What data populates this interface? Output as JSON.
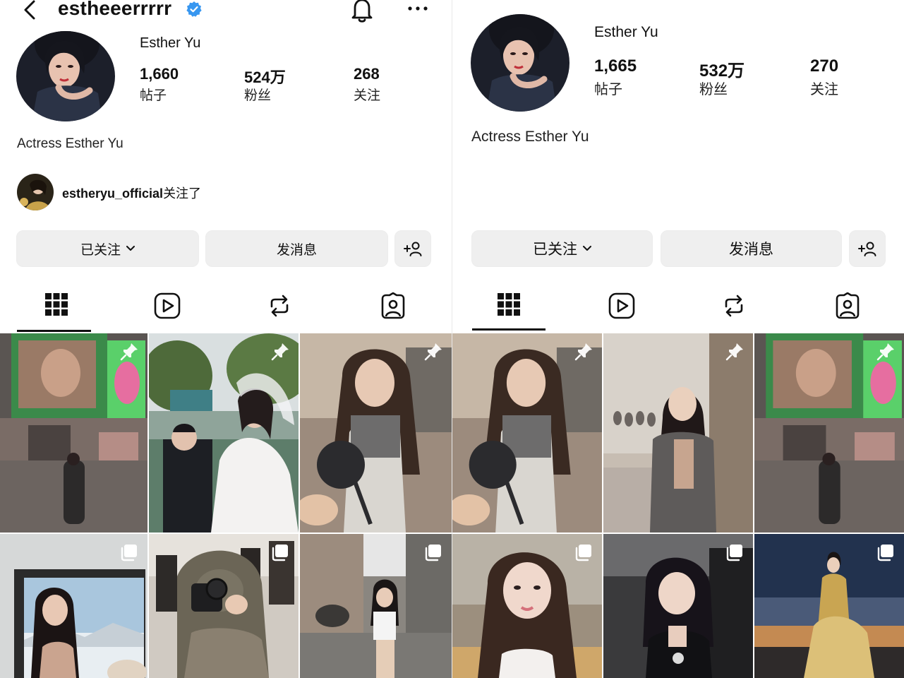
{
  "left": {
    "handle": "estheeerrrrr",
    "name": "Esther Yu",
    "stats": [
      {
        "value": "1,660",
        "label": "帖子"
      },
      {
        "value": "524万",
        "label": "粉丝"
      },
      {
        "value": "268",
        "label": "关注"
      }
    ],
    "bio": "Actress Esther Yu",
    "followed_by": {
      "user": "estheryu_official",
      "suffix": "关注了"
    },
    "buttons": {
      "following": "已关注",
      "message": "发消息"
    },
    "tab_icons": [
      "grid-icon",
      "reels-icon",
      "repost-icon",
      "tagged-icon"
    ],
    "tiles": [
      {
        "scene": "city-billboard-street",
        "badge": "pin-icon"
      },
      {
        "scene": "wedding-proposal",
        "badge": "pin-icon"
      },
      {
        "scene": "girl-with-microphone",
        "badge": "pin-icon"
      },
      {
        "scene": "window-snow-mountains",
        "badge": "carousel-icon"
      },
      {
        "scene": "mirror-selfie-closet",
        "badge": "carousel-icon"
      },
      {
        "scene": "alley-street",
        "badge": "carousel-icon"
      }
    ]
  },
  "right": {
    "name": "Esther Yu",
    "stats": [
      {
        "value": "1,665",
        "label": "帖子"
      },
      {
        "value": "532万",
        "label": "粉丝"
      },
      {
        "value": "270",
        "label": "关注"
      }
    ],
    "bio": "Actress Esther Yu",
    "buttons": {
      "following": "已关注",
      "message": "发消息"
    },
    "tab_icons": [
      "grid-icon",
      "reels-icon",
      "repost-icon",
      "tagged-icon"
    ],
    "tiles": [
      {
        "scene": "girl-with-microphone",
        "badge": "pin-icon"
      },
      {
        "scene": "bedroom-jacket",
        "badge": "pin-icon"
      },
      {
        "scene": "city-billboard-street",
        "badge": "pin-icon"
      },
      {
        "scene": "portrait-sunset-hair",
        "badge": "carousel-icon"
      },
      {
        "scene": "car-black-dress",
        "badge": "carousel-icon"
      },
      {
        "scene": "gold-gown-dusk",
        "badge": "carousel-icon"
      }
    ]
  },
  "colors": {
    "verified": "#3897f0",
    "button_bg": "#efefef",
    "text": "#111111"
  }
}
